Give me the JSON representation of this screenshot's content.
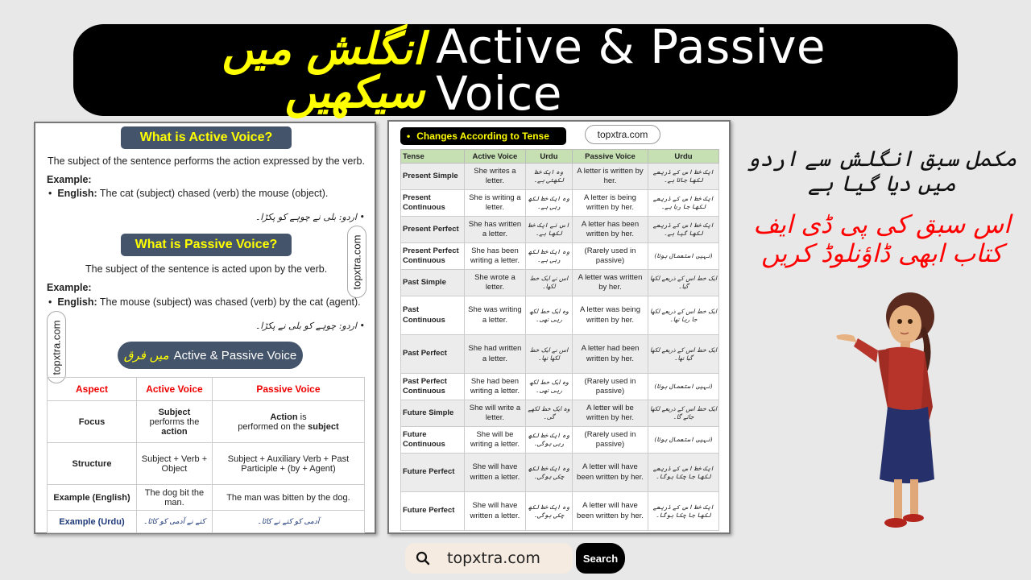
{
  "banner": {
    "urdu": "انگلش میں سیکھیں",
    "english": "Active & Passive Voice"
  },
  "left_card": {
    "active": {
      "title": "What is Active Voice?",
      "definition": "The subject of the sentence performs the action expressed by the verb.",
      "example_label": "Example:",
      "english_label": "English:",
      "english_text": "The cat (subject) chased (verb) the mouse (object).",
      "urdu_text": "اردو: بلی نے چوہے کو پکڑا۔"
    },
    "passive": {
      "title": "What is Passive Voice?",
      "definition": "The subject of the sentence is acted upon by the verb.",
      "example_label": "Example:",
      "english_label": "English:",
      "english_text": "The mouse (subject) was chased (verb) by the cat (agent).",
      "urdu_text": "اردو: چوہے کو بلی نے پکڑا۔"
    },
    "watermark": "topxtra.com",
    "difference_title_en": "Active & Passive Voice",
    "difference_title_urdu": "میں فرق",
    "comparison": {
      "headers": [
        "Aspect",
        "Active Voice",
        "Passive Voice"
      ],
      "rows": [
        {
          "aspect": "Focus",
          "active_bold": "Subject",
          "active_rest": "performs the ",
          "active_bold2": "action",
          "passive_bold": "Action",
          "passive_rest": " is",
          "passive_line2": "performed on the ",
          "passive_bold2": "subject"
        },
        {
          "aspect": "Structure",
          "active": "Subject + Verb + Object",
          "passive": "Subject + Auxiliary Verb + Past Participle + (by + Agent)"
        },
        {
          "aspect": "Example (English)",
          "active": "The dog bit the man.",
          "passive": "The man was bitten by the dog."
        },
        {
          "aspect": "Example (Urdu)",
          "active": "کتے نے آدمی کو کاٹا۔",
          "passive": "آدمی کو کتے نے کاٹا۔"
        }
      ]
    }
  },
  "mid_card": {
    "title": "Changes According to Tense",
    "bullet": "•",
    "site": "topxtra.com",
    "headers": [
      "Tense",
      "Active Voice",
      "Urdu",
      "Passive Voice",
      "Urdu"
    ],
    "rows": [
      {
        "tense": "Present Simple",
        "active": "She writes a letter.",
        "urdu_a": "وہ ایک خط لکھتی ہے۔",
        "passive": "A letter is written by her.",
        "urdu_p": "ایک خط اس کے ذریعے لکھا جاتا ہے۔"
      },
      {
        "tense": "Present Continuous",
        "active": "She is writing a letter.",
        "urdu_a": "وہ ایک خط لکھ رہی ہے۔",
        "passive": "A letter is being written by her.",
        "urdu_p": "ایک خط اس کے ذریعے لکھا جا رہا ہے۔"
      },
      {
        "tense": "Present Perfect",
        "active": "She has written a letter.",
        "urdu_a": "اس نے ایک خط لکھا ہے۔",
        "passive": "A letter has been written by her.",
        "urdu_p": "ایک خط اس کے ذریعے لکھا گیا ہے۔"
      },
      {
        "tense": "Present Perfect Continuous",
        "active": "She has been writing a letter.",
        "urdu_a": "وہ ایک خط لکھ رہی ہے۔",
        "passive": "(Rarely used in passive)",
        "urdu_p": "(نہیں استعمال ہوتا)"
      },
      {
        "tense": "Past Simple",
        "active": "She wrote a letter.",
        "urdu_a": "اس نے ایک خط لکھا۔",
        "passive": "A letter was written by her.",
        "urdu_p": "ایک خط اس کے ذریعے لکھا گیا۔"
      },
      {
        "tense": "Past Continuous",
        "active": "She was writing a letter.",
        "urdu_a": "وہ ایک خط لکھ رہی تھی۔",
        "passive": "A letter was being written by her.",
        "urdu_p": "ایک خط اس کے ذریعے لکھا جا رہا تھا۔"
      },
      {
        "tense": "Past Perfect",
        "active": "She had written a letter.",
        "urdu_a": "اس نے ایک خط لکھا تھا۔",
        "passive": "A letter had been written by her.",
        "urdu_p": "ایک خط اس کے ذریعے لکھا گیا تھا۔"
      },
      {
        "tense": "Past Perfect Continuous",
        "active": "She had been writing a letter.",
        "urdu_a": "وہ ایک خط لکھ رہی تھی۔",
        "passive": "(Rarely used in passive)",
        "urdu_p": "(نہیں استعمال ہوتا)"
      },
      {
        "tense": "Future Simple",
        "active": "She will write a letter.",
        "urdu_a": "وہ ایک خط لکھے گی۔",
        "passive": "A letter will be written by her.",
        "urdu_p": "ایک خط اس کے ذریعے لکھا جائے گا۔"
      },
      {
        "tense": "Future Continuous",
        "active": "She will be writing a letter.",
        "urdu_a": "وہ ایک خط لکھ رہی ہوگی۔",
        "passive": "(Rarely used in passive)",
        "urdu_p": "(نہیں استعمال ہوتا)"
      },
      {
        "tense": "Future Perfect",
        "active": "She will have written a letter.",
        "urdu_a": "وہ ایک خط لکھ چکی ہوگی۔",
        "passive": "A letter will have been written by her.",
        "urdu_p": "ایک خط اس کے ذریعے لکھا جا چکا ہوگا۔"
      },
      {
        "tense": "Future Perfect",
        "active": "She will have written a letter.",
        "urdu_a": "وہ ایک خط لکھ چکی ہوگی۔",
        "passive": "A letter will have been written by her.",
        "urdu_p": "ایک خط اس کے ذریعے لکھا جا چکا ہوگا۔"
      }
    ]
  },
  "right": {
    "line1": "مکمل سبق انگلش سے اردو میں دیا گیا ہے",
    "line2": "اس سبق کی پی ڈی ایف",
    "line3": "کتاب ابھی ڈاؤنلوڈ کریں",
    "figure": "teacher-illustration"
  },
  "search": {
    "value": "topxtra.com",
    "button": "Search",
    "icon": "search-icon"
  }
}
